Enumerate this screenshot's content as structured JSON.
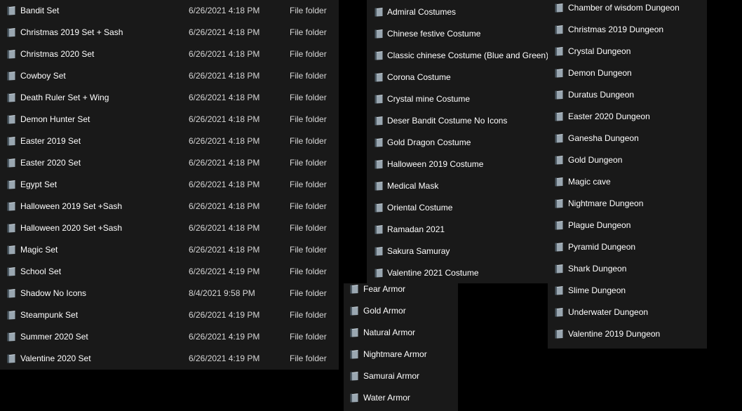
{
  "colors": {
    "background": "#000000",
    "panel": "#191919",
    "text": "#ffffff",
    "secondary_text": "#d6d6d6",
    "icon_face": "#9aa7b1",
    "icon_dark": "#4d5a64"
  },
  "icon": "folder-icon",
  "panels": {
    "sets": {
      "items": [
        {
          "name": "Bandit Set",
          "date": "6/26/2021 4:18 PM",
          "type": "File folder"
        },
        {
          "name": "Christmas 2019 Set + Sash",
          "date": "6/26/2021 4:18 PM",
          "type": "File folder"
        },
        {
          "name": "Christmas 2020 Set",
          "date": "6/26/2021 4:18 PM",
          "type": "File folder"
        },
        {
          "name": "Cowboy Set",
          "date": "6/26/2021 4:18 PM",
          "type": "File folder"
        },
        {
          "name": "Death Ruler Set + Wing",
          "date": "6/26/2021 4:18 PM",
          "type": "File folder"
        },
        {
          "name": "Demon Hunter Set",
          "date": "6/26/2021 4:18 PM",
          "type": "File folder"
        },
        {
          "name": "Easter 2019 Set",
          "date": "6/26/2021 4:18 PM",
          "type": "File folder"
        },
        {
          "name": "Easter 2020 Set",
          "date": "6/26/2021 4:18 PM",
          "type": "File folder"
        },
        {
          "name": "Egypt Set",
          "date": "6/26/2021 4:18 PM",
          "type": "File folder"
        },
        {
          "name": "Halloween 2019 Set +Sash",
          "date": "6/26/2021 4:18 PM",
          "type": "File folder"
        },
        {
          "name": "Halloween 2020 Set +Sash",
          "date": "6/26/2021 4:18 PM",
          "type": "File folder"
        },
        {
          "name": "Magic Set",
          "date": "6/26/2021 4:18 PM",
          "type": "File folder"
        },
        {
          "name": "School Set",
          "date": "6/26/2021 4:19 PM",
          "type": "File folder"
        },
        {
          "name": "Shadow No Icons",
          "date": "8/4/2021 9:58 PM",
          "type": "File folder"
        },
        {
          "name": "Steampunk Set",
          "date": "6/26/2021 4:19 PM",
          "type": "File folder"
        },
        {
          "name": "Summer 2020 Set",
          "date": "6/26/2021 4:19 PM",
          "type": "File folder"
        },
        {
          "name": "Valentine 2020 Set",
          "date": "6/26/2021 4:19 PM",
          "type": "File folder"
        }
      ]
    },
    "costumes": {
      "items": [
        "Admiral Costumes",
        "Chinese festive Costume",
        "Classic chinese Costume (Blue and Green)",
        "Corona Costume",
        "Crystal mine Costume",
        "Deser Bandit Costume No Icons",
        "Gold Dragon Costume",
        "Halloween 2019 Costume",
        "Medical Mask",
        "Oriental Costume",
        "Ramadan 2021",
        "Sakura Samuray",
        "Valentine 2021 Costume"
      ]
    },
    "armors": {
      "items": [
        "Fear Armor",
        "Gold Armor",
        "Natural Armor",
        "Nightmare Armor",
        "Samurai Armor",
        "Water Armor"
      ]
    },
    "dungeons": {
      "items": [
        "Chamber of wisdom Dungeon",
        "Christmas 2019 Dungeon",
        "Crystal Dungeon",
        "Demon Dungeon",
        "Duratus Dungeon",
        "Easter 2020 Dungeon",
        "Ganesha Dungeon",
        "Gold Dungeon",
        "Magic cave",
        "Nightmare Dungeon",
        "Plague Dungeon",
        "Pyramid Dungeon",
        "Shark Dungeon",
        "Slime Dungeon",
        "Underwater Dungeon",
        "Valentine 2019 Dungeon"
      ]
    }
  }
}
